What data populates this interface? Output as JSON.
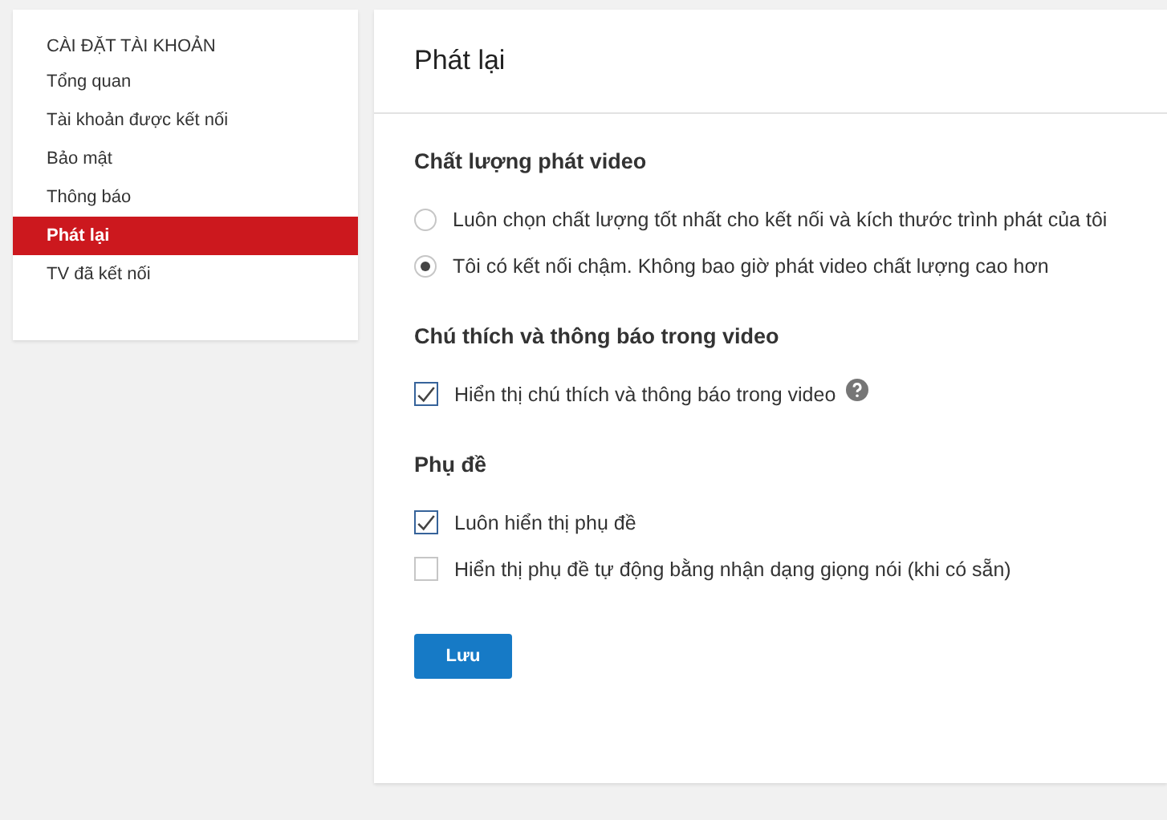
{
  "sidebar": {
    "heading": "CÀI ĐẶT TÀI KHOẢN",
    "items": [
      {
        "label": "Tổng quan",
        "selected": false
      },
      {
        "label": "Tài khoản được kết nối",
        "selected": false
      },
      {
        "label": "Bảo mật",
        "selected": false
      },
      {
        "label": "Thông báo",
        "selected": false
      },
      {
        "label": "Phát lại",
        "selected": true
      },
      {
        "label": "TV đã kết nối",
        "selected": false
      }
    ]
  },
  "page": {
    "title": "Phát lại",
    "sections": [
      {
        "title": "Chất lượng phát video",
        "options": [
          {
            "kind": "radio",
            "label": "Luôn chọn chất lượng tốt nhất cho kết nối và kích thước trình phát của tôi",
            "selected": false
          },
          {
            "kind": "radio",
            "label": "Tôi có kết nối chậm. Không bao giờ phát video chất lượng cao hơn",
            "selected": true
          }
        ]
      },
      {
        "title": "Chú thích và thông báo trong video",
        "options": [
          {
            "kind": "checkbox",
            "label": "Hiển thị chú thích và thông báo trong video",
            "checked": true,
            "help": true
          }
        ]
      },
      {
        "title": "Phụ đề",
        "options": [
          {
            "kind": "checkbox",
            "label": "Luôn hiển thị phụ đề",
            "checked": true
          },
          {
            "kind": "checkbox",
            "label": "Hiển thị phụ đề tự động bằng nhận dạng giọng nói (khi có sẵn)",
            "checked": false
          }
        ]
      }
    ],
    "save_button": "Lưu"
  }
}
